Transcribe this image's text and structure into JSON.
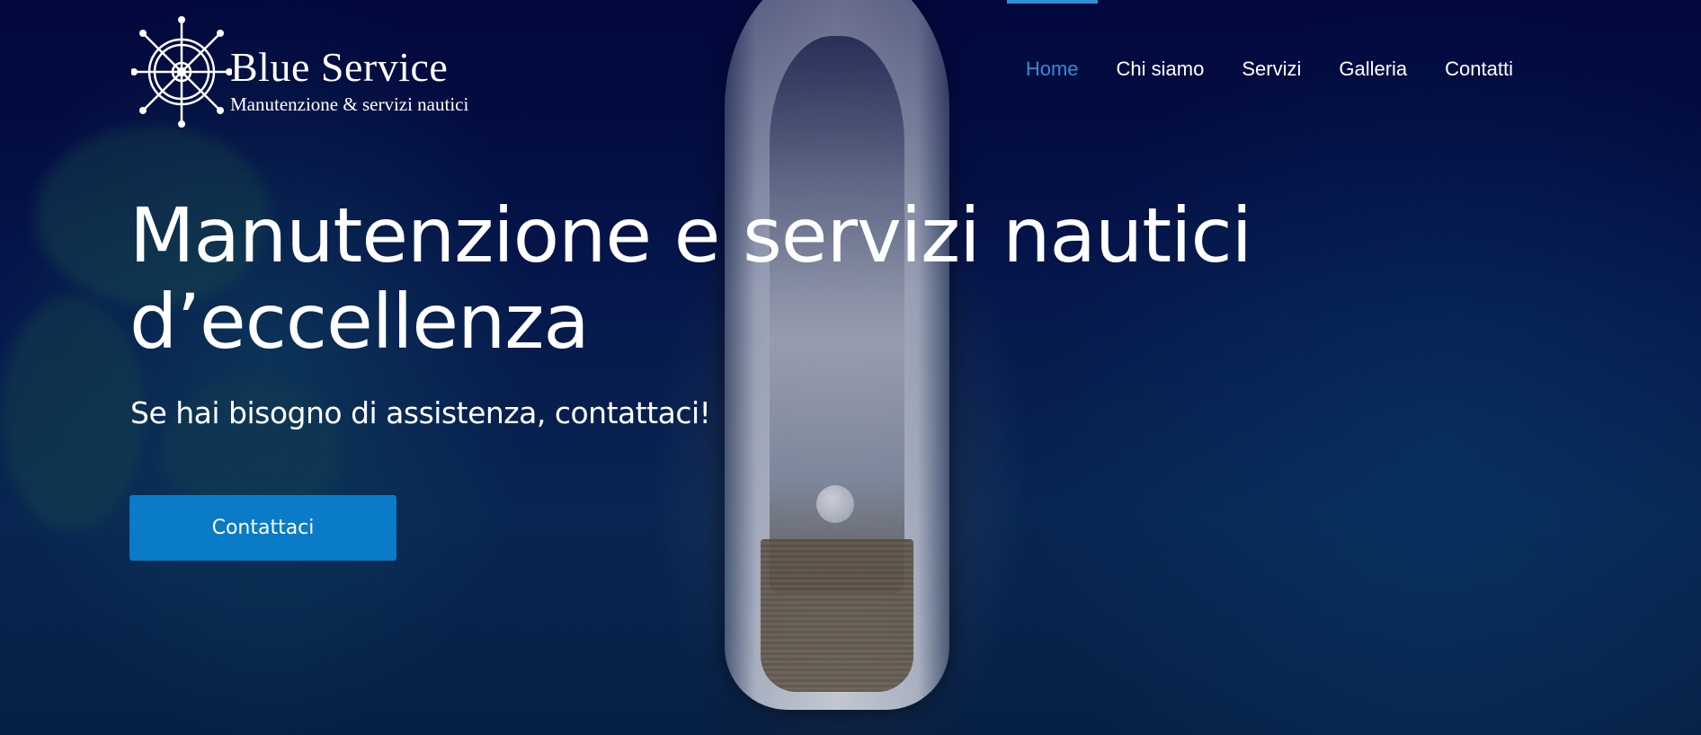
{
  "brand": {
    "title": "Blue Service",
    "subtitle": "Manutenzione & servizi nautici",
    "logo_icon": "ship-wheel-icon"
  },
  "nav": {
    "items": [
      {
        "label": "Home",
        "active": true
      },
      {
        "label": "Chi siamo",
        "active": false
      },
      {
        "label": "Servizi",
        "active": false
      },
      {
        "label": "Galleria",
        "active": false
      },
      {
        "label": "Contatti",
        "active": false
      }
    ]
  },
  "hero": {
    "title_line1": "Manutenzione e servizi nautici",
    "title_line2": "d’eccellenza",
    "subtitle": "Se hai bisogno di assistenza, contattaci!",
    "cta_label": "Contattaci"
  },
  "colors": {
    "accent": "#0a7bc6",
    "nav_active": "#2d8fd6",
    "background_deep": "#04133a"
  }
}
